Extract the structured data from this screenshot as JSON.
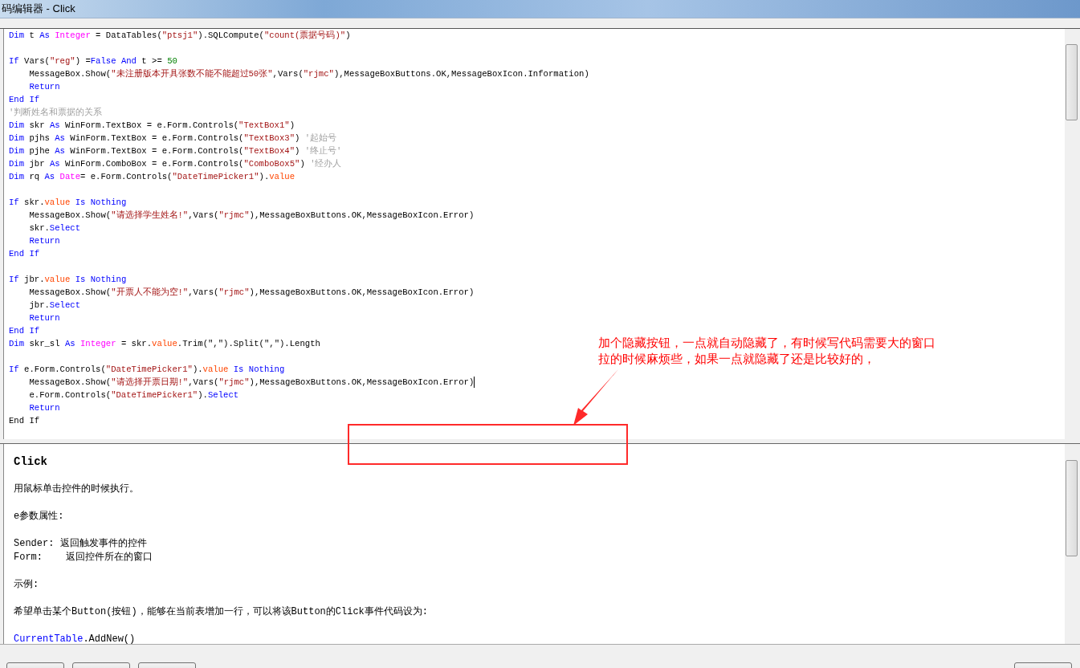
{
  "window": {
    "title": "码编辑器 - Click"
  },
  "code": {
    "lines": [
      {
        "tokens": [
          {
            "kind": "kw",
            "text": "Dim"
          },
          {
            "kind": "t",
            "text": " t "
          },
          {
            "kind": "kw",
            "text": "As "
          },
          {
            "kind": "ty",
            "text": "Integer"
          },
          {
            "kind": "t",
            "text": " = DataTables("
          },
          {
            "kind": "s",
            "text": "\"ptsj1\""
          },
          {
            "kind": "t",
            "text": ").SQLCompute("
          },
          {
            "kind": "s",
            "text": "\"count(票据号码)\""
          },
          {
            "kind": "t",
            "text": ")"
          }
        ]
      },
      {
        "kind": "blank"
      },
      {
        "tokens": [
          {
            "kind": "kw",
            "text": "If"
          },
          {
            "kind": "t",
            "text": " Vars("
          },
          {
            "kind": "s",
            "text": "\"reg\""
          },
          {
            "kind": "t",
            "text": ") ="
          },
          {
            "kind": "kw",
            "text": "False And"
          },
          {
            "kind": "t",
            "text": " t >= "
          },
          {
            "kind": "n",
            "text": "50"
          }
        ]
      },
      {
        "tokens": [
          {
            "kind": "t",
            "text": "    MessageBox.Show("
          },
          {
            "kind": "s",
            "text": "\"未注册版本开具张数不能不能超过50张\""
          },
          {
            "kind": "t",
            "text": ",Vars("
          },
          {
            "kind": "s",
            "text": "\"rjmc\""
          },
          {
            "kind": "t",
            "text": "),MessageBoxButtons.OK,MessageBoxIcon.Information)"
          }
        ]
      },
      {
        "tokens": [
          {
            "kind": "kw",
            "text": "    Return"
          }
        ]
      },
      {
        "tokens": [
          {
            "kind": "kw",
            "text": "End If"
          }
        ]
      },
      {
        "tokens": [
          {
            "kind": "c",
            "text": "'判断姓名和票据的关系"
          }
        ]
      },
      {
        "tokens": [
          {
            "kind": "kw",
            "text": "Dim"
          },
          {
            "kind": "t",
            "text": " skr "
          },
          {
            "kind": "kw",
            "text": "As"
          },
          {
            "kind": "t",
            "text": " WinForm.TextBox = e.Form.Controls("
          },
          {
            "kind": "s",
            "text": "\"TextBox1\""
          },
          {
            "kind": "t",
            "text": ")"
          }
        ]
      },
      {
        "tokens": [
          {
            "kind": "kw",
            "text": "Dim"
          },
          {
            "kind": "t",
            "text": " pjhs "
          },
          {
            "kind": "kw",
            "text": "As"
          },
          {
            "kind": "t",
            "text": " WinForm.TextBox = e.Form.Controls("
          },
          {
            "kind": "s",
            "text": "\"TextBox3\""
          },
          {
            "kind": "t",
            "text": ") "
          },
          {
            "kind": "c",
            "text": "'起始号"
          }
        ]
      },
      {
        "tokens": [
          {
            "kind": "kw",
            "text": "Dim"
          },
          {
            "kind": "t",
            "text": " pjhe "
          },
          {
            "kind": "kw",
            "text": "As"
          },
          {
            "kind": "t",
            "text": " WinForm.TextBox = e.Form.Controls("
          },
          {
            "kind": "s",
            "text": "\"TextBox4\""
          },
          {
            "kind": "t",
            "text": ") "
          },
          {
            "kind": "c",
            "text": "'终止号'"
          }
        ]
      },
      {
        "tokens": [
          {
            "kind": "kw",
            "text": "Dim"
          },
          {
            "kind": "t",
            "text": " jbr "
          },
          {
            "kind": "kw",
            "text": "As"
          },
          {
            "kind": "t",
            "text": " WinForm.ComboBox = e.Form.Controls("
          },
          {
            "kind": "s",
            "text": "\"ComboBox5\""
          },
          {
            "kind": "t",
            "text": ") "
          },
          {
            "kind": "c",
            "text": "'经办人"
          }
        ]
      },
      {
        "tokens": [
          {
            "kind": "kw",
            "text": "Dim"
          },
          {
            "kind": "t",
            "text": " rq "
          },
          {
            "kind": "kw",
            "text": "As "
          },
          {
            "kind": "ty",
            "text": "Date"
          },
          {
            "kind": "t",
            "text": "= e.Form.Controls("
          },
          {
            "kind": "s",
            "text": "\"DateTimePicker1\""
          },
          {
            "kind": "t",
            "text": ")."
          },
          {
            "kind": "p",
            "text": "value"
          }
        ]
      },
      {
        "kind": "blank"
      },
      {
        "tokens": [
          {
            "kind": "kw",
            "text": "If"
          },
          {
            "kind": "t",
            "text": " skr."
          },
          {
            "kind": "p",
            "text": "value"
          },
          {
            "kind": "kw",
            "text": " Is Nothing"
          }
        ]
      },
      {
        "tokens": [
          {
            "kind": "t",
            "text": "    MessageBox.Show("
          },
          {
            "kind": "s",
            "text": "\"请选择学生姓名!\""
          },
          {
            "kind": "t",
            "text": ",Vars("
          },
          {
            "kind": "s",
            "text": "\"rjmc\""
          },
          {
            "kind": "t",
            "text": "),MessageBoxButtons.OK,MessageBoxIcon.Error)"
          }
        ]
      },
      {
        "tokens": [
          {
            "kind": "t",
            "text": "    skr."
          },
          {
            "kind": "kw",
            "text": "Select"
          }
        ]
      },
      {
        "tokens": [
          {
            "kind": "kw",
            "text": "    Return"
          }
        ]
      },
      {
        "tokens": [
          {
            "kind": "kw",
            "text": "End If"
          }
        ]
      },
      {
        "kind": "blank"
      },
      {
        "tokens": [
          {
            "kind": "kw",
            "text": "If"
          },
          {
            "kind": "t",
            "text": " jbr."
          },
          {
            "kind": "p",
            "text": "value"
          },
          {
            "kind": "kw",
            "text": " Is Nothing"
          }
        ]
      },
      {
        "tokens": [
          {
            "kind": "t",
            "text": "    MessageBox.Show("
          },
          {
            "kind": "s",
            "text": "\"开票人不能为空!\""
          },
          {
            "kind": "t",
            "text": ",Vars("
          },
          {
            "kind": "s",
            "text": "\"rjmc\""
          },
          {
            "kind": "t",
            "text": "),MessageBoxButtons.OK,MessageBoxIcon.Error)"
          }
        ]
      },
      {
        "tokens": [
          {
            "kind": "t",
            "text": "    jbr."
          },
          {
            "kind": "kw",
            "text": "Select"
          }
        ]
      },
      {
        "tokens": [
          {
            "kind": "kw",
            "text": "    Return"
          }
        ]
      },
      {
        "tokens": [
          {
            "kind": "kw",
            "text": "End If"
          }
        ]
      },
      {
        "tokens": [
          {
            "kind": "kw",
            "text": "Dim"
          },
          {
            "kind": "t",
            "text": " skr_sl "
          },
          {
            "kind": "kw",
            "text": "As "
          },
          {
            "kind": "ty",
            "text": "Integer"
          },
          {
            "kind": "t",
            "text": " = skr."
          },
          {
            "kind": "p",
            "text": "value"
          },
          {
            "kind": "t",
            "text": ".Trim(\",\").Split(\",\").Length"
          }
        ]
      },
      {
        "kind": "blank"
      },
      {
        "tokens": [
          {
            "kind": "kw",
            "text": "If"
          },
          {
            "kind": "t",
            "text": " e.Form.Controls("
          },
          {
            "kind": "s",
            "text": "\"DateTimePicker1\""
          },
          {
            "kind": "t",
            "text": ")."
          },
          {
            "kind": "p",
            "text": "value"
          },
          {
            "kind": "kw",
            "text": " Is Nothing"
          }
        ]
      },
      {
        "cursor": true,
        "tokens": [
          {
            "kind": "t",
            "text": "    MessageBox.Show("
          },
          {
            "kind": "s",
            "text": "\"请选择开票日期!\""
          },
          {
            "kind": "t",
            "text": ",Vars("
          },
          {
            "kind": "s",
            "text": "\"rjmc\""
          },
          {
            "kind": "t",
            "text": "),MessageBoxButtons.OK,MessageBoxIcon.Error)"
          }
        ]
      },
      {
        "tokens": [
          {
            "kind": "t",
            "text": "    e.Form.Controls("
          },
          {
            "kind": "s",
            "text": "\"DateTimePicker1\""
          },
          {
            "kind": "t",
            "text": ")."
          },
          {
            "kind": "kw",
            "text": "Select"
          }
        ]
      },
      {
        "tokens": [
          {
            "kind": "kw",
            "text": "    Return"
          }
        ]
      },
      {
        "tokens": [
          {
            "kind": "t",
            "text": "End If"
          }
        ]
      }
    ]
  },
  "help": {
    "lines": [
      {
        "kind": "heading",
        "tokens": [
          {
            "kind": "t",
            "text": "Click"
          }
        ]
      },
      {
        "kind": "blank"
      },
      {
        "kind": "text",
        "tokens": [
          {
            "kind": "t",
            "text": "用鼠标单击控件的时候执行。"
          }
        ]
      },
      {
        "kind": "blank"
      },
      {
        "kind": "text",
        "tokens": [
          {
            "kind": "t",
            "text": "e参数属性:"
          }
        ]
      },
      {
        "kind": "blank"
      },
      {
        "kind": "text",
        "tokens": [
          {
            "kind": "t",
            "text": "Sender: 返回触发事件的控件"
          }
        ]
      },
      {
        "kind": "text",
        "tokens": [
          {
            "kind": "t",
            "text": "Form:    返回控件所在的窗口"
          }
        ]
      },
      {
        "kind": "blank"
      },
      {
        "kind": "text",
        "tokens": [
          {
            "kind": "t",
            "text": "示例:"
          }
        ]
      },
      {
        "kind": "blank"
      },
      {
        "kind": "text",
        "tokens": [
          {
            "kind": "t",
            "text": "希望单击某个Button(按钮)，能够在当前表增加一行，可以将该Button的Click事件代码设为:"
          }
        ]
      },
      {
        "kind": "blank"
      },
      {
        "kind": "text",
        "tokens": [
          {
            "kind": "kw",
            "text": "CurrentTable"
          },
          {
            "kind": "t",
            "text": ".AddNew()"
          }
        ]
      }
    ]
  },
  "bottom_buttons": [
    {
      "kind": "left"
    },
    {
      "kind": "left"
    },
    {
      "kind": "left"
    },
    {
      "kind": "right"
    }
  ],
  "annotation": {
    "text": "加个隐藏按钮，一点就自动隐藏了，有时候写代码需要大的窗口拉的时候麻烦些，如果一点就隐藏了还是比较好的，"
  }
}
